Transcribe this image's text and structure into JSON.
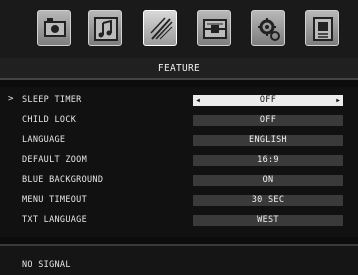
{
  "icons": [
    {
      "name": "picture-icon",
      "active": false
    },
    {
      "name": "music-note-icon",
      "active": false
    },
    {
      "name": "feature-icon",
      "active": true
    },
    {
      "name": "input-source-icon",
      "active": false
    },
    {
      "name": "setup-gear-icon",
      "active": false
    },
    {
      "name": "channel-list-icon",
      "active": false
    }
  ],
  "page_title": "FEATURE",
  "menu": {
    "items": [
      {
        "label": "SLEEP TIMER",
        "value": "OFF",
        "selected": true,
        "cursor": ">"
      },
      {
        "label": "CHILD LOCK",
        "value": "OFF"
      },
      {
        "label": "LANGUAGE",
        "value": "ENGLISH"
      },
      {
        "label": "DEFAULT ZOOM",
        "value": "16:9"
      },
      {
        "label": "BLUE BACKGROUND",
        "value": "ON"
      },
      {
        "label": "MENU TIMEOUT",
        "value": "30 SEC"
      },
      {
        "label": "TXT LANGUAGE",
        "value": "WEST"
      }
    ]
  },
  "footer": {
    "status": "NO SIGNAL"
  },
  "colors": {
    "selected_value_bg": "#ececec",
    "value_bg": "#3a3a3a",
    "text": "#e6e6e6"
  }
}
